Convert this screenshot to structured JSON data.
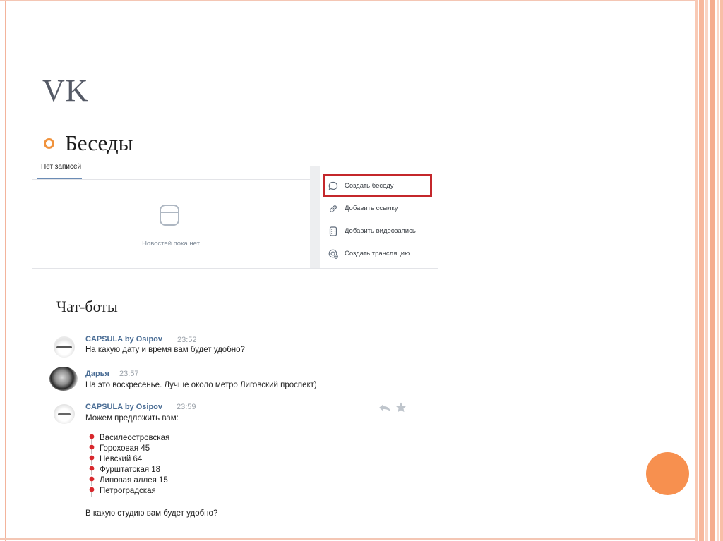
{
  "slide": {
    "title": "VK",
    "bullet": "Беседы",
    "section2": "Чат-боты"
  },
  "colors": {
    "accent_orange": "#f7904f",
    "highlight_red": "#c4272b",
    "vk_link_blue": "#4a6d95"
  },
  "feed": {
    "tab_label": "Нет записей",
    "empty_text": "Новостей пока нет",
    "empty_icon": "post-icon"
  },
  "menu": {
    "items": [
      {
        "label": "Создать беседу",
        "icon": "chat-bubble-icon",
        "highlighted": true
      },
      {
        "label": "Добавить ссылку",
        "icon": "link-icon"
      },
      {
        "label": "Добавить видеозапись",
        "icon": "film-icon"
      },
      {
        "label": "Создать трансляцию",
        "icon": "broadcast-icon"
      }
    ]
  },
  "chat": {
    "messages": [
      {
        "author": "CAPSULA by Osipov",
        "time": "23:52",
        "text": "На какую дату и время вам будет удобно?"
      },
      {
        "author": "Дарья",
        "time": "23:57",
        "text": "На это воскресенье. Лучше около метро Лиговский проспект)"
      },
      {
        "author": "CAPSULA by Osipov",
        "time": "23:59",
        "text": "Можем предложить вам:"
      }
    ],
    "locations": [
      "Василеостровская",
      "Гороховая 45",
      "Невский 64",
      "Фурштатская 18",
      "Липовая аллея 15",
      "Петроградская"
    ],
    "location_icon": "round-pushpin-icon",
    "closing": "В какую студию вам будет удобно?",
    "actions": [
      "reply-icon",
      "star-icon"
    ]
  }
}
